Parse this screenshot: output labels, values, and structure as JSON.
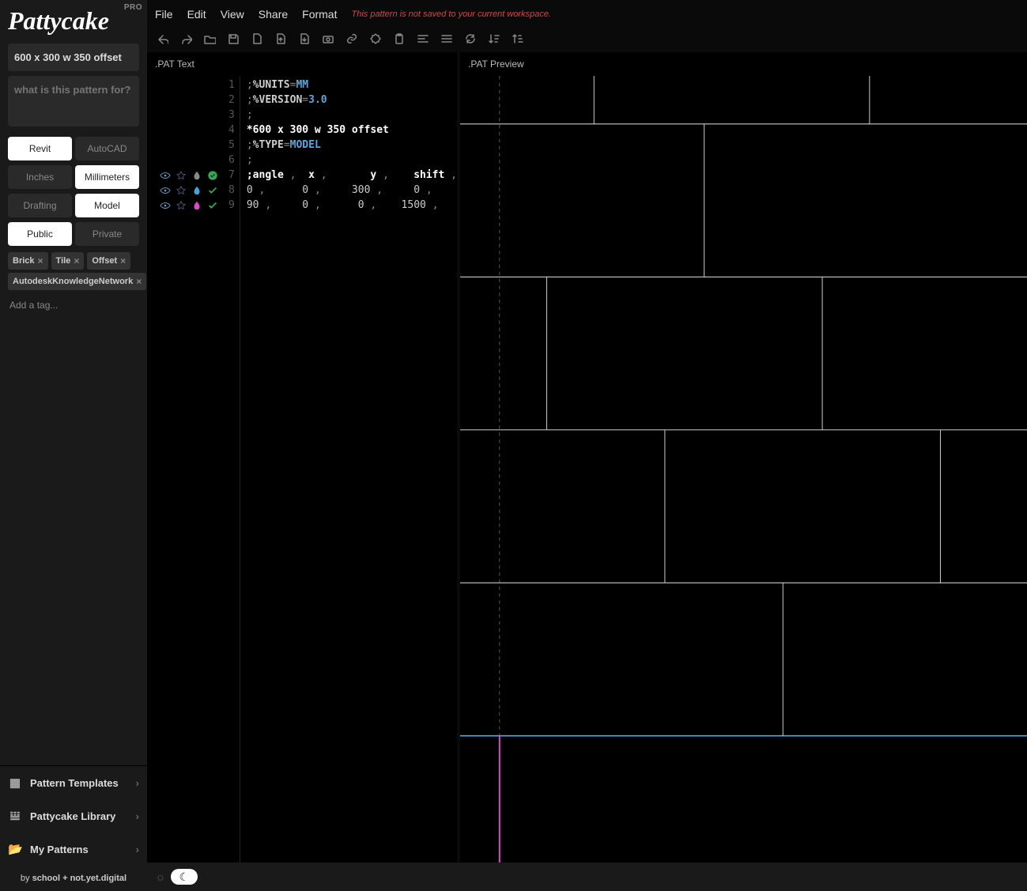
{
  "app": {
    "name": "Pattycake",
    "plan": "PRO"
  },
  "menubar": [
    "File",
    "Edit",
    "View",
    "Share",
    "Format"
  ],
  "warning": "This pattern is not saved to your current workspace.",
  "sidebar": {
    "title": "600 x 300 w 350 offset",
    "desc_placeholder": "what is this pattern for?",
    "toggles": {
      "software": {
        "left": "Revit",
        "right": "AutoCAD",
        "active": "left"
      },
      "units": {
        "left": "Inches",
        "right": "Millimeters",
        "active": "right"
      },
      "type": {
        "left": "Drafting",
        "right": "Model",
        "active": "right"
      },
      "visibility": {
        "left": "Public",
        "right": "Private",
        "active": "left"
      }
    },
    "tags": [
      "Brick",
      "Tile",
      "Offset",
      "AutodeskKnowledgeNetwork"
    ],
    "add_tag_placeholder": "Add a tag...",
    "nav": [
      {
        "label": "Pattern Templates",
        "icon": "grid"
      },
      {
        "label": "Pattycake Library",
        "icon": "books"
      },
      {
        "label": "My Patterns",
        "icon": "folder"
      }
    ],
    "credits_prefix": "by ",
    "credits": "school + not.yet.digital"
  },
  "panels": {
    "text_header": ".PAT Text",
    "preview_header": ".PAT Preview"
  },
  "code_lines": [
    {
      "n": 1,
      "html": "<span class='tok-comment'>;</span><span class='tok-kw'>%UNITS</span><span class='tok-punct'>=</span><span class='tok-val'>MM</span>"
    },
    {
      "n": 2,
      "html": "<span class='tok-comment'>;</span><span class='tok-kw'>%VERSION</span><span class='tok-punct'>=</span><span class='tok-val'>3.0</span>"
    },
    {
      "n": 3,
      "html": "<span class='tok-comment'>;</span>"
    },
    {
      "n": 4,
      "html": "<span class='tok-pname'>*600 x 300 w 350 offset</span>"
    },
    {
      "n": 5,
      "html": "<span class='tok-comment'>;</span><span class='tok-kw'>%TYPE</span><span class='tok-punct'>=</span><span class='tok-val'>MODEL</span>"
    },
    {
      "n": 6,
      "html": "<span class='tok-comment'>;</span>"
    },
    {
      "n": 7,
      "html": "<span class='tok-head'>;angle</span><span class='tok-punct'> , </span><span class='tok-head'> x </span><span class='tok-punct'>,      </span><span class='tok-head'> y </span><span class='tok-punct'>,    </span><span class='tok-head'>shift</span><span class='tok-punct'> ,</span>",
      "marks": {
        "eye": true,
        "star": "outline",
        "drop": "#888",
        "check": "green-solid"
      }
    },
    {
      "n": 8,
      "html": "<span class='tok-num'>0 </span><span class='tok-punct'>,     </span><span class='tok-num'> 0 </span><span class='tok-punct'>,    </span><span class='tok-num'> 300 </span><span class='tok-punct'>,    </span><span class='tok-num'> 0 </span><span class='tok-punct'>,</span>",
      "marks": {
        "eye": true,
        "star": "outline",
        "drop": "#4aa0d8",
        "check": "green"
      }
    },
    {
      "n": 9,
      "html": "<span class='tok-num'>90 </span><span class='tok-punct'>,    </span><span class='tok-num'> 0 </span><span class='tok-punct'>,    </span><span class='tok-num'>  0 </span><span class='tok-punct'>,   </span><span class='tok-num'> 1500 </span><span class='tok-punct'>,</span>",
      "marks": {
        "eye": true,
        "star": "outline",
        "drop": "#d94cc7",
        "check": "green"
      }
    }
  ],
  "toolbar_icons": [
    "undo",
    "redo",
    "open",
    "save",
    "new-file",
    "export",
    "import",
    "camera",
    "link",
    "badge",
    "clipboard",
    "align-left",
    "align-justify",
    "refresh",
    "sort-down",
    "sort-up"
  ]
}
